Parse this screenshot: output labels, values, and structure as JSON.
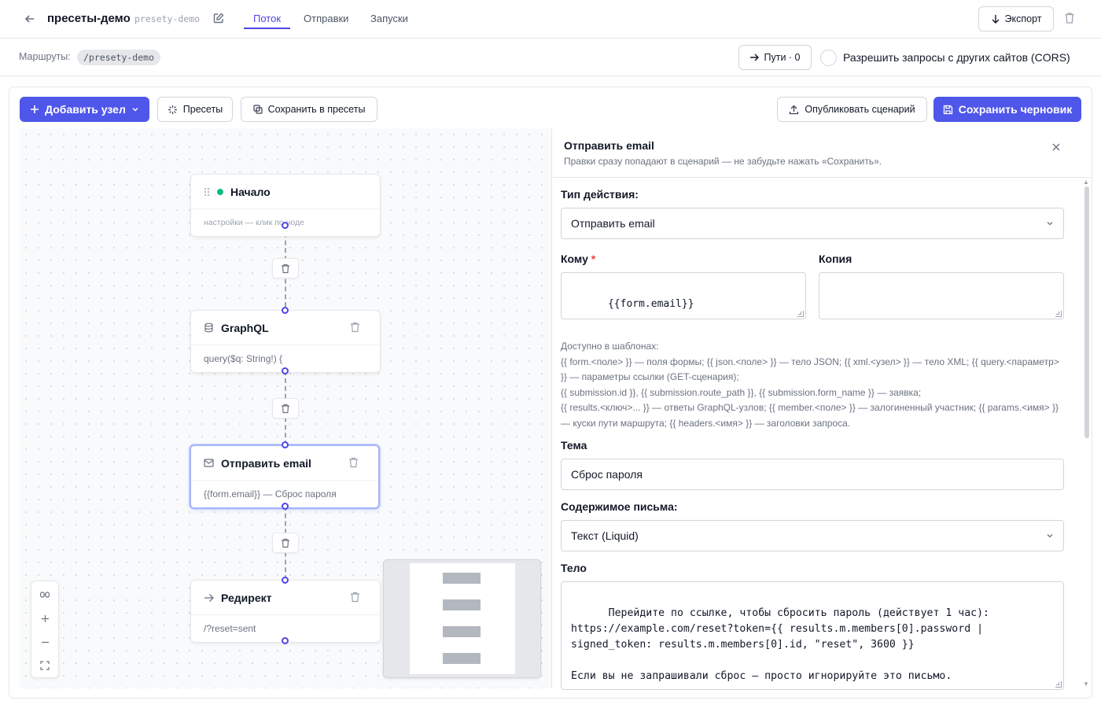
{
  "header": {
    "title": "пресеты-демо",
    "slug": "presety-demo",
    "tabs": [
      "Поток",
      "Отправки",
      "Запуски"
    ],
    "export_label": "Экспорт"
  },
  "routes": {
    "label": "Маршруты:",
    "route": "/presety-demo",
    "paths_label": "Пути · 0",
    "cors_label": "Разрешить запросы с других сайтов (CORS)",
    "cors_checked": false
  },
  "toolbar": {
    "add_node": "Добавить узел",
    "presets": "Пресеты",
    "save_to_presets": "Сохранить в пресеты",
    "publish": "Опубликовать сценарий",
    "save_draft": "Сохранить черновик"
  },
  "flow": {
    "nodes": [
      {
        "title": "Начало",
        "subtitle": "настройки — клик по ноде",
        "icon": "drag-handle-icon"
      },
      {
        "title": "GraphQL",
        "subtitle": "query($q: String!) {",
        "icon": "database-icon"
      },
      {
        "title": "Отправить email",
        "subtitle": "{{form.email}} — Сброс пароля",
        "icon": "mail-icon",
        "selected": true
      },
      {
        "title": "Редирект",
        "subtitle": "/?reset=sent",
        "icon": "arrow-right-icon"
      }
    ]
  },
  "panel": {
    "title": "Отправить email",
    "subtitle": "Правки сразу попадают в сценарий — не забудьте нажать «Сохранить».",
    "action_type_label": "Тип действия:",
    "action_type_value": "Отправить email",
    "to_label": "Кому",
    "to_required": "*",
    "to_value": "{{form.email}}",
    "cc_label": "Копия",
    "cc_value": "",
    "template_help": [
      "Доступно в шаблонах:",
      "{{ form.<поле> }} — поля формы; {{ json.<поле> }} — тело JSON; {{ xml.<узел> }} — тело XML; {{ query.<параметр> }} — параметры ссылки (GET-сценария);",
      "{{ submission.id }}, {{ submission.route_path }}, {{ submission.form_name }} — заявка;",
      "{{ results.<ключ>... }} — ответы GraphQL-узлов; {{ member.<поле> }} — залогиненный участник; {{ params.<имя> }} — куски пути маршрута; {{ headers.<имя> }} — заголовки запроса."
    ],
    "subject_label": "Тема",
    "subject_value": "Сброс пароля",
    "content_label": "Содержимое письма:",
    "content_value": "Текст (Liquid)",
    "body_label": "Тело",
    "body_value": "Перейдите по ссылке, чтобы сбросить пароль (действует 1 час):\nhttps://example.com/reset?token={{ results.m.members[0].password |\nsigned_token: results.m.members[0].id, \"reset\", 3600 }}\n\nЕсли вы не запрашивали сброс — просто игнорируйте это письмо."
  },
  "colors": {
    "accent": "#4f46e5",
    "primary_button": "#4f56ea",
    "start_dot": "#10b981",
    "required": "#ef4444"
  }
}
